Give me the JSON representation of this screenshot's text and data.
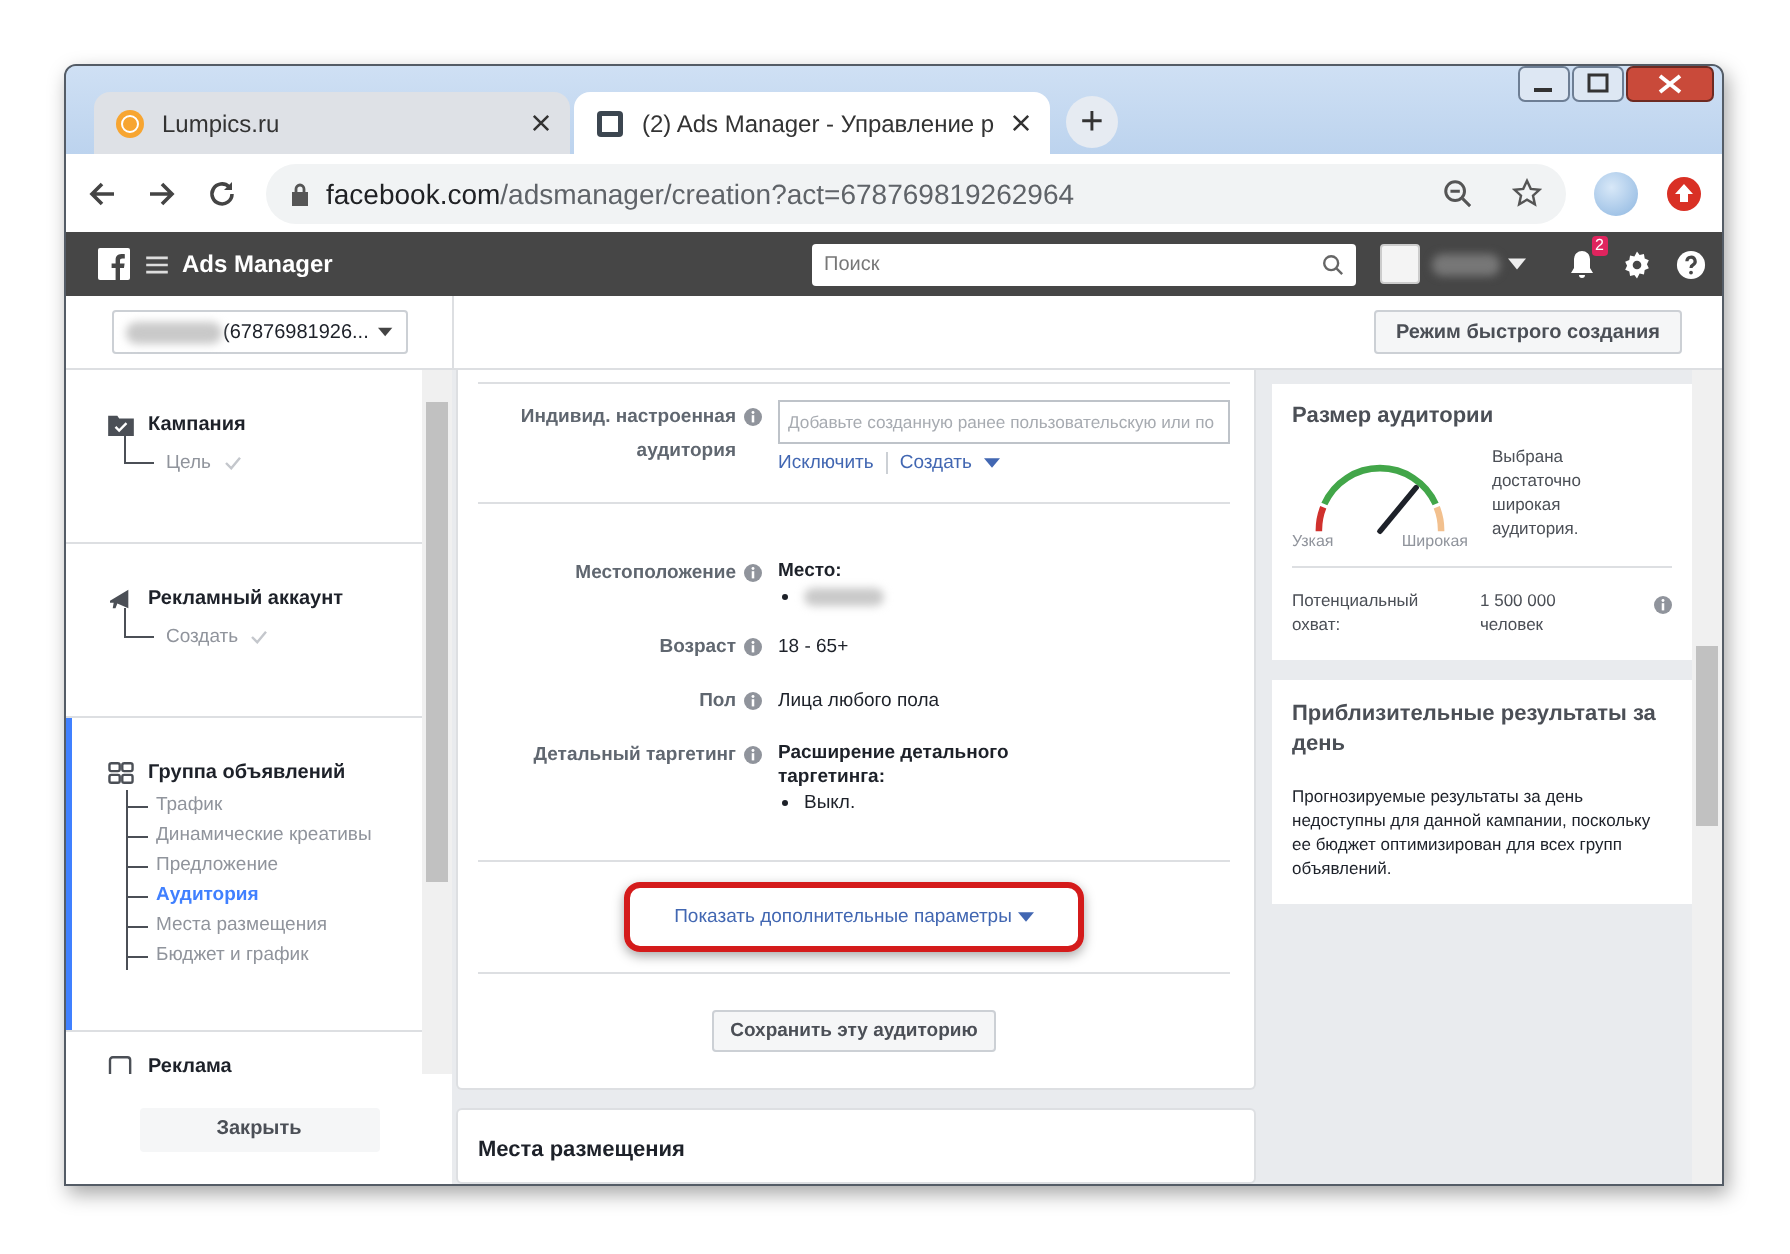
{
  "browser": {
    "tabs": [
      {
        "title": "Lumpics.ru",
        "kind": "site",
        "selected": false
      },
      {
        "title": "(2) Ads Manager - Управление р",
        "kind": "page",
        "selected": true
      }
    ],
    "new_tab": "+",
    "url_host": "facebook.com",
    "url_path": "/adsmanager/creation?act=678769819262964"
  },
  "fb_bar": {
    "title": "Ads Manager",
    "search_placeholder": "Поиск",
    "notifications": "2"
  },
  "subheader": {
    "account": "(67876981926...",
    "quick_mode_button": "Режим быстрого создания"
  },
  "sidebar": {
    "sections": [
      {
        "kind": "campaign",
        "title": "Кампания",
        "selected": false,
        "children": [
          {
            "label": "Цель",
            "done": true,
            "selected": false
          }
        ]
      },
      {
        "kind": "account",
        "title": "Рекламный аккаунт",
        "selected": false,
        "children": [
          {
            "label": "Создать",
            "done": true,
            "selected": false
          }
        ]
      },
      {
        "kind": "adset",
        "title": "Группа объявлений",
        "selected": true,
        "children": [
          {
            "label": "Трафик",
            "done": false,
            "selected": false
          },
          {
            "label": "Динамические креативы",
            "done": false,
            "selected": false
          },
          {
            "label": "Предложение",
            "done": false,
            "selected": false
          },
          {
            "label": "Аудитория",
            "done": false,
            "selected": true
          },
          {
            "label": "Места размещения",
            "done": false,
            "selected": false
          },
          {
            "label": "Бюджет и график",
            "done": false,
            "selected": false
          }
        ]
      },
      {
        "kind": "ad",
        "title": "Реклама",
        "selected": false
      }
    ],
    "close_button": "Закрыть"
  },
  "audience_form": {
    "custom_audience": {
      "label": "Индивид. настроенная аудитория",
      "placeholder": "Добавьте созданную ранее пользовательскую или по",
      "links": [
        "Исключить",
        "Создать"
      ]
    },
    "rows": [
      {
        "kind": "location",
        "label": "Местоположение",
        "title": "Место:"
      },
      {
        "kind": "text",
        "label": "Возраст",
        "value": "18 - 65+"
      },
      {
        "kind": "text",
        "label": "Пол",
        "value": "Лица любого пола"
      },
      {
        "kind": "list",
        "label": "Детальный таргетинг",
        "title": "Расширение детального таргетинга:",
        "bullets": [
          "Выкл."
        ]
      }
    ],
    "show_more": {
      "label": "Показать дополнительные параметры",
      "highlighted": true
    },
    "save_button": "Сохранить эту аудиторию"
  },
  "next_section": {
    "title": "Места размещения"
  },
  "audience_size": {
    "title": "Размер аудитории",
    "gauge": {
      "low": "Узкая",
      "high": "Широкая"
    },
    "verdict": "Выбрана достаточно широкая аудитория.",
    "reach_label": "Потенциальный охват:",
    "reach_value": "1 500 000 человек"
  },
  "estimates": {
    "title": "Приблизительные результаты за день",
    "text": "Прогнозируемые результаты за день недоступны для данной кампании, поскольку ее бюджет оптимизирован для всех групп объявлений."
  }
}
